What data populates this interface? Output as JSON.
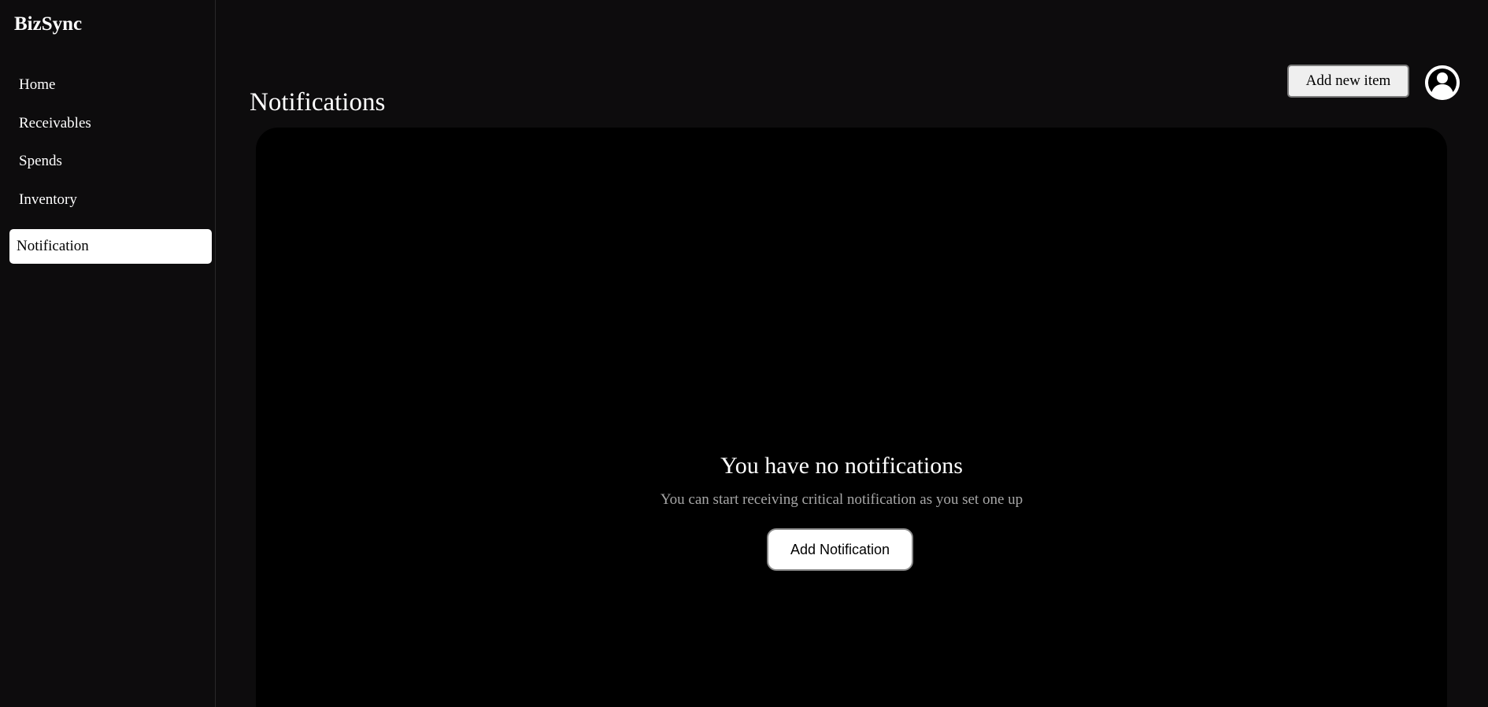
{
  "app": {
    "brand": "BizSync"
  },
  "sidebar": {
    "items": [
      {
        "label": "Home"
      },
      {
        "label": "Receivables"
      },
      {
        "label": "Spends"
      },
      {
        "label": "Inventory"
      },
      {
        "label": "Notification",
        "active": true
      }
    ]
  },
  "header": {
    "page_title": "Notifications",
    "add_item_label": "Add new item",
    "avatar_icon": "user-avatar-icon"
  },
  "empty_state": {
    "title": "You have no notifications",
    "subtitle": "You can start receiving critical notification as you set one up",
    "button_label": "Add Notification"
  },
  "colors": {
    "background": "#0d0c0d",
    "panel": "#000000",
    "active_nav_bg": "#ffffff",
    "text": "#ffffff",
    "muted_text": "#a6a6a6"
  }
}
